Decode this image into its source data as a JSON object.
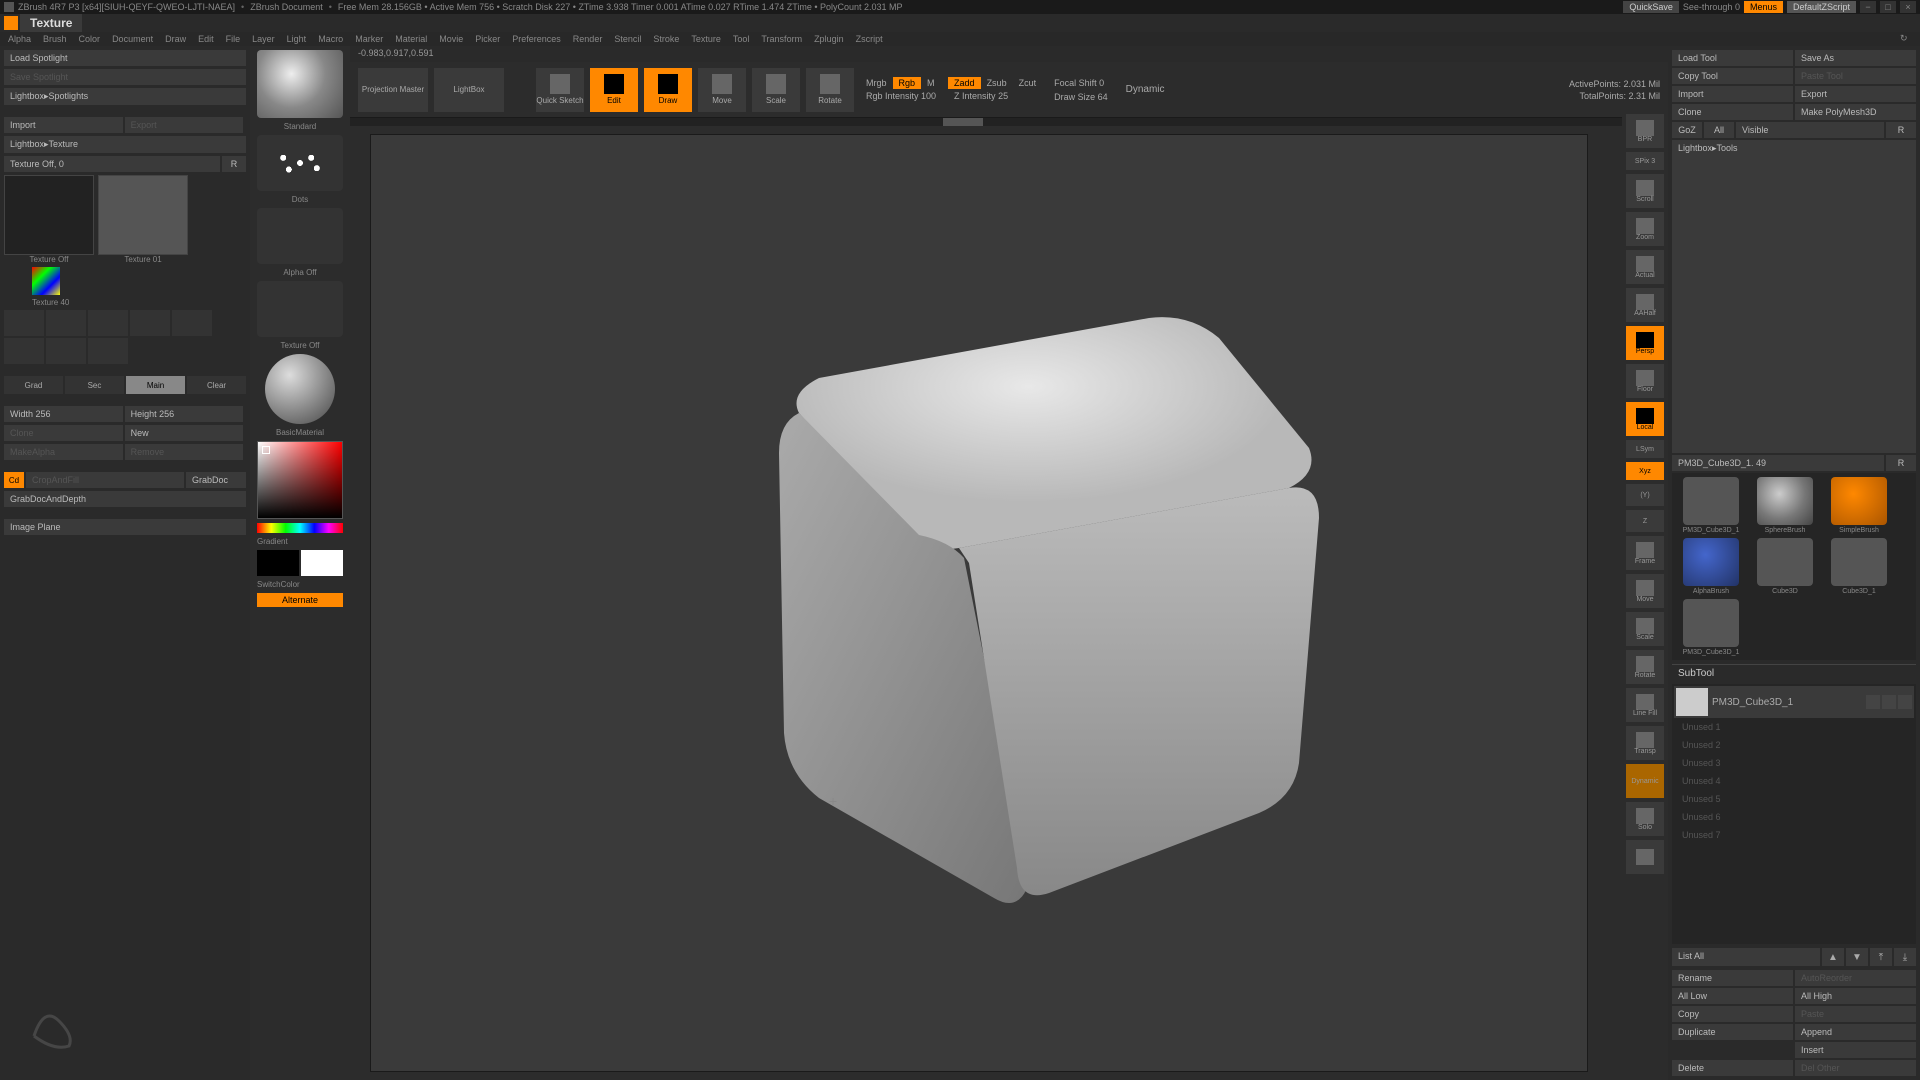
{
  "titlebar": {
    "app": "ZBrush 4R7 P3 [x64][SIUH-QEYF-QWEO-LJTI-NAEA]",
    "doc": "ZBrush Document",
    "stats": "Free Mem 28.156GB • Active Mem 756 • Scratch Disk 227 • ZTime 3.938 Timer 0.001 ATime 0.027 RTime 1.474 ZTime • PolyCount 2.031 MP",
    "quicksave": "QuickSave",
    "seethrough": "See-through  0",
    "menus": "Menus",
    "script": "DefaultZScript"
  },
  "panel_title": "Texture",
  "menu": [
    "Alpha",
    "Brush",
    "Color",
    "Document",
    "Draw",
    "Edit",
    "File",
    "Layer",
    "Light",
    "Macro",
    "Marker",
    "Material",
    "Movie",
    "Picker",
    "Preferences",
    "Render",
    "Stencil",
    "Stroke",
    "Texture",
    "Tool",
    "Transform",
    "Zplugin",
    "Zscript"
  ],
  "coords": "-0.983,0.917,0.591",
  "left": {
    "load_spotlight": "Load Spotlight",
    "save_spotlight": "Save Spotlight",
    "lightbox_spot": "Lightbox▸Spotlights",
    "import": "Import",
    "export": "Export",
    "lightbox_tex": "Lightbox▸Texture",
    "texture_off": "Texture Off, 0",
    "r": "R",
    "tex_off_lbl": "Texture Off",
    "tex_01": "Texture 01",
    "tex_40": "Texture 40",
    "grad": "Grad",
    "sec": "Sec",
    "main": "Main",
    "clear": "Clear",
    "width": "Width 256",
    "height": "Height 256",
    "clone": "Clone",
    "new": "New",
    "makealpha": "MakeAlpha",
    "remove": "Remove",
    "cd": "Cd",
    "cropfill": "CropAndFill",
    "grabdoc": "GrabDoc",
    "grabdocdepth": "GrabDocAndDepth",
    "imageplane": "Image Plane"
  },
  "brushcol": {
    "standard": "Standard",
    "dots": "Dots",
    "alpha_off": "Alpha Off",
    "basicmat": "BasicMaterial",
    "gradient": "Gradient",
    "switchcolor": "SwitchColor",
    "alternate": "Alternate"
  },
  "toolbar": {
    "projection": "Projection Master",
    "lightbox": "LightBox",
    "quicksketch": "Quick Sketch",
    "edit": "Edit",
    "draw": "Draw",
    "move": "Move",
    "scale": "Scale",
    "rotate": "Rotate",
    "mrgb": "Mrgb",
    "rgb": "Rgb",
    "m": "M",
    "rgb_intensity": "Rgb Intensity 100",
    "zadd": "Zadd",
    "zsub": "Zsub",
    "zcut": "Zcut",
    "z_intensity": "Z Intensity 25",
    "focal": "Focal Shift 0",
    "drawsize": "Draw Size 64",
    "dynamic": "Dynamic",
    "activepoints": "ActivePoints: 2.031 Mil",
    "totalpoints": "TotalPoints: 2.31 Mil"
  },
  "rightgutter": {
    "bpr": "BPR",
    "spix": "SPix 3",
    "scroll": "Scroll",
    "zoom": "Zoom",
    "actual": "Actual",
    "aahalf": "AAHalf",
    "persp": "Persp",
    "floor": "Floor",
    "local": "Local",
    "lsym": "LSym",
    "xyz": "Xyz",
    "frame": "Frame",
    "move": "Move",
    "scale": "Scale",
    "rotate": "Rotate",
    "linefill": "Line Fill",
    "transp": "Transp",
    "dynamic": "Dynamic",
    "solo": "Solo"
  },
  "right": {
    "load_tool": "Load Tool",
    "save_as": "Save As",
    "copy_tool": "Copy Tool",
    "paste_tool": "Paste Tool",
    "import": "Import",
    "export": "Export",
    "clone": "Clone",
    "make_poly": "Make PolyMesh3D",
    "goz": "GoZ",
    "all": "All",
    "visible": "Visible",
    "r": "R",
    "lightbox_tools": "Lightbox▸Tools",
    "current_tool": "PM3D_Cube3D_1. 49",
    "tools": [
      {
        "name": "PM3D_Cube3D_1"
      },
      {
        "name": "SphereBrush"
      },
      {
        "name": "SimpleBrush"
      },
      {
        "name": "AlphaBrush"
      },
      {
        "name": "Cube3D"
      },
      {
        "name": "Cube3D_1"
      },
      {
        "name": "PM3D_Cube3D_1"
      }
    ],
    "subtool": "SubTool",
    "subtool_name": "PM3D_Cube3D_1",
    "unused": [
      "Unused 1",
      "Unused 2",
      "Unused 3",
      "Unused 4",
      "Unused 5",
      "Unused 6",
      "Unused 7"
    ],
    "list_all": "List All",
    "rename": "Rename",
    "autoreorder": "AutoReorder",
    "all_low": "All Low",
    "all_high": "All High",
    "copy": "Copy",
    "paste": "Paste",
    "duplicate": "Duplicate",
    "append": "Append",
    "insert": "Insert",
    "delete": "Delete",
    "del_other": "Del Other"
  }
}
